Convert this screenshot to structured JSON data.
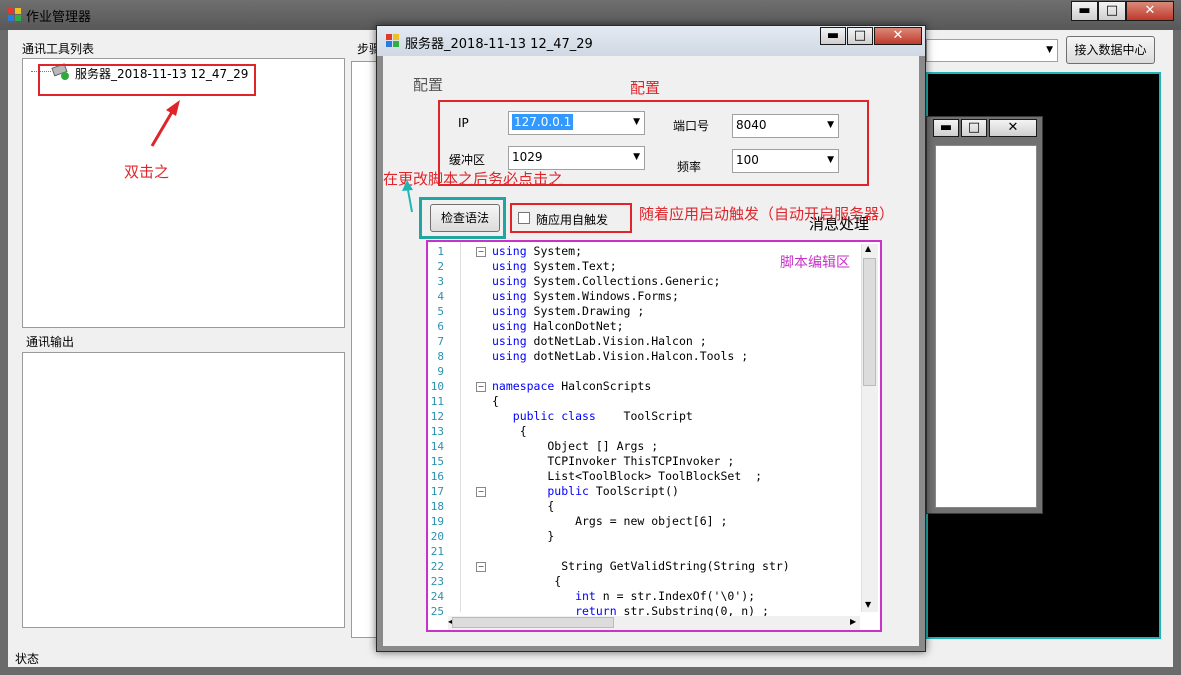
{
  "main": {
    "title": "作业管理器",
    "comm_tools_label": "通讯工具列表",
    "tree_item": "服务器_2018-11-13 12_47_29",
    "comm_output_label": "通讯输出",
    "steps_label": "步骤",
    "connect_button": "接入数据中心",
    "status_label": "状态"
  },
  "dialog": {
    "title": "服务器_2018-11-13 12_47_29",
    "config_group": "配置",
    "ip_label": "IP",
    "ip_value": "127.0.0.1",
    "port_label": "端口号",
    "port_value": "8040",
    "buffer_label": "缓冲区",
    "buffer_value": "1029",
    "freq_label": "频率",
    "freq_value": "100",
    "check_syntax_button": "检查语法",
    "auto_trigger_checkbox": "随应用自触发",
    "message_processing": "消息处理"
  },
  "annotations": {
    "double_click": "双击之",
    "config": "配置",
    "click_after_edit": "在更改脚本之后务必点击之",
    "auto_trigger_note": "随着应用启动触发（自动开启服务器）",
    "script_editor": "脚本编辑区"
  },
  "code_lines": [
    {
      "n": "1",
      "kw": "using",
      "rest": " System;"
    },
    {
      "n": "2",
      "kw": "using",
      "rest": " System.Text;"
    },
    {
      "n": "3",
      "kw": "using",
      "rest": " System.Collections.Generic;"
    },
    {
      "n": "4",
      "kw": "using",
      "rest": " System.Windows.Forms;"
    },
    {
      "n": "5",
      "kw": "using",
      "rest": " System.Drawing ;"
    },
    {
      "n": "6",
      "kw": "using",
      "rest": " HalconDotNet;"
    },
    {
      "n": "7",
      "kw": "using",
      "rest": " dotNetLab.Vision.Halcon ;"
    },
    {
      "n": "8",
      "kw": "using",
      "rest": " dotNetLab.Vision.Halcon.Tools ;"
    },
    {
      "n": "9",
      "kw": "",
      "rest": ""
    },
    {
      "n": "10",
      "kw": "namespace",
      "rest": " HalconScripts"
    },
    {
      "n": "11",
      "kw": "",
      "rest": "{"
    },
    {
      "n": "12",
      "kw": "   public class",
      "rest": "    ToolScript"
    },
    {
      "n": "13",
      "kw": "",
      "rest": "    {"
    },
    {
      "n": "14",
      "kw": "",
      "rest": "        Object [] Args ;"
    },
    {
      "n": "15",
      "kw": "",
      "rest": "        TCPInvoker ThisTCPInvoker ;"
    },
    {
      "n": "16",
      "kw": "",
      "rest": "        List<ToolBlock> ToolBlockSet  ;"
    },
    {
      "n": "17",
      "kw": "        public",
      "rest": " ToolScript()"
    },
    {
      "n": "18",
      "kw": "",
      "rest": "        {"
    },
    {
      "n": "19",
      "kw": "",
      "rest": "            Args = new object[6] ;"
    },
    {
      "n": "20",
      "kw": "",
      "rest": "        }"
    },
    {
      "n": "21",
      "kw": "",
      "rest": ""
    },
    {
      "n": "22",
      "kw": "",
      "rest": "          String GetValidString(String str)"
    },
    {
      "n": "23",
      "kw": "",
      "rest": "         {"
    },
    {
      "n": "24",
      "kw": "            int",
      "rest": " n = str.IndexOf('\\0');"
    },
    {
      "n": "25",
      "kw": "            return",
      "rest": " str.Substring(0, n) ;"
    }
  ],
  "colors": {
    "annotation_red": "#e0252a",
    "annotation_magenta": "#c832c8",
    "annotation_teal": "#1fb5b5"
  }
}
